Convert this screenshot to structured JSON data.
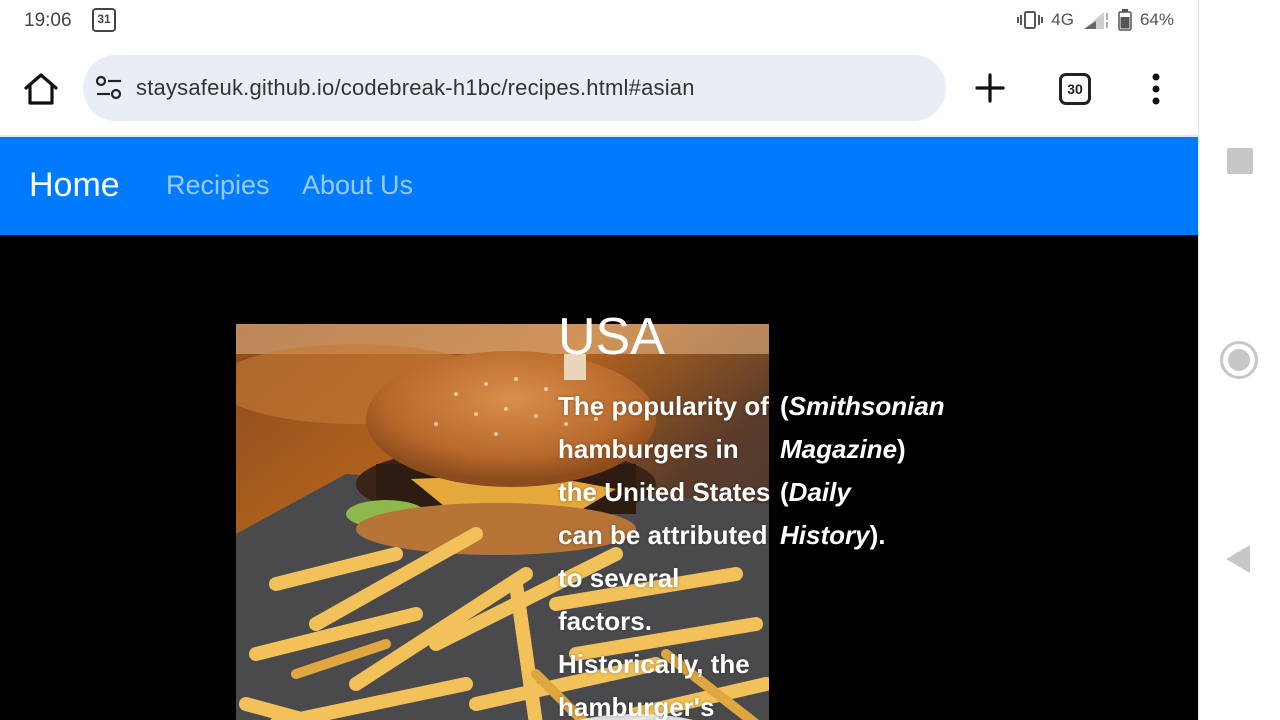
{
  "status_bar": {
    "time": "19:06",
    "calendar_day": "31",
    "network": "4G",
    "battery": "64%"
  },
  "browser": {
    "url": "staysafeuk.github.io/codebreak-h1bc/recipes.html#asian",
    "tab_count": "30",
    "icons": [
      "home-icon",
      "site-settings-icon",
      "new-tab-icon",
      "tab-switcher-icon",
      "more-menu-icon"
    ]
  },
  "site_nav": {
    "brand": "Home",
    "links": [
      "Recipies",
      "About Us"
    ],
    "bg_color": "#007bff"
  },
  "article": {
    "heading": "USA",
    "main_lines": [
      "The popularity of",
      "hamburgers in",
      "the United States",
      "can be attributed",
      "to several",
      "factors.",
      "Historically, the",
      "hamburger's"
    ],
    "citations": [
      {
        "open": "(",
        "name": "Smithsonian",
        "close": ""
      },
      {
        "open": "",
        "name": "Magazine",
        "close": ")"
      },
      {
        "open": "(",
        "name": "Daily",
        "close": ""
      },
      {
        "open": "",
        "name": "History",
        "close": ")."
      }
    ],
    "image_alt": "burger-and-fries-photo"
  },
  "system_nav": {
    "icons": [
      "recents-icon",
      "home-button-icon",
      "back-icon"
    ]
  }
}
